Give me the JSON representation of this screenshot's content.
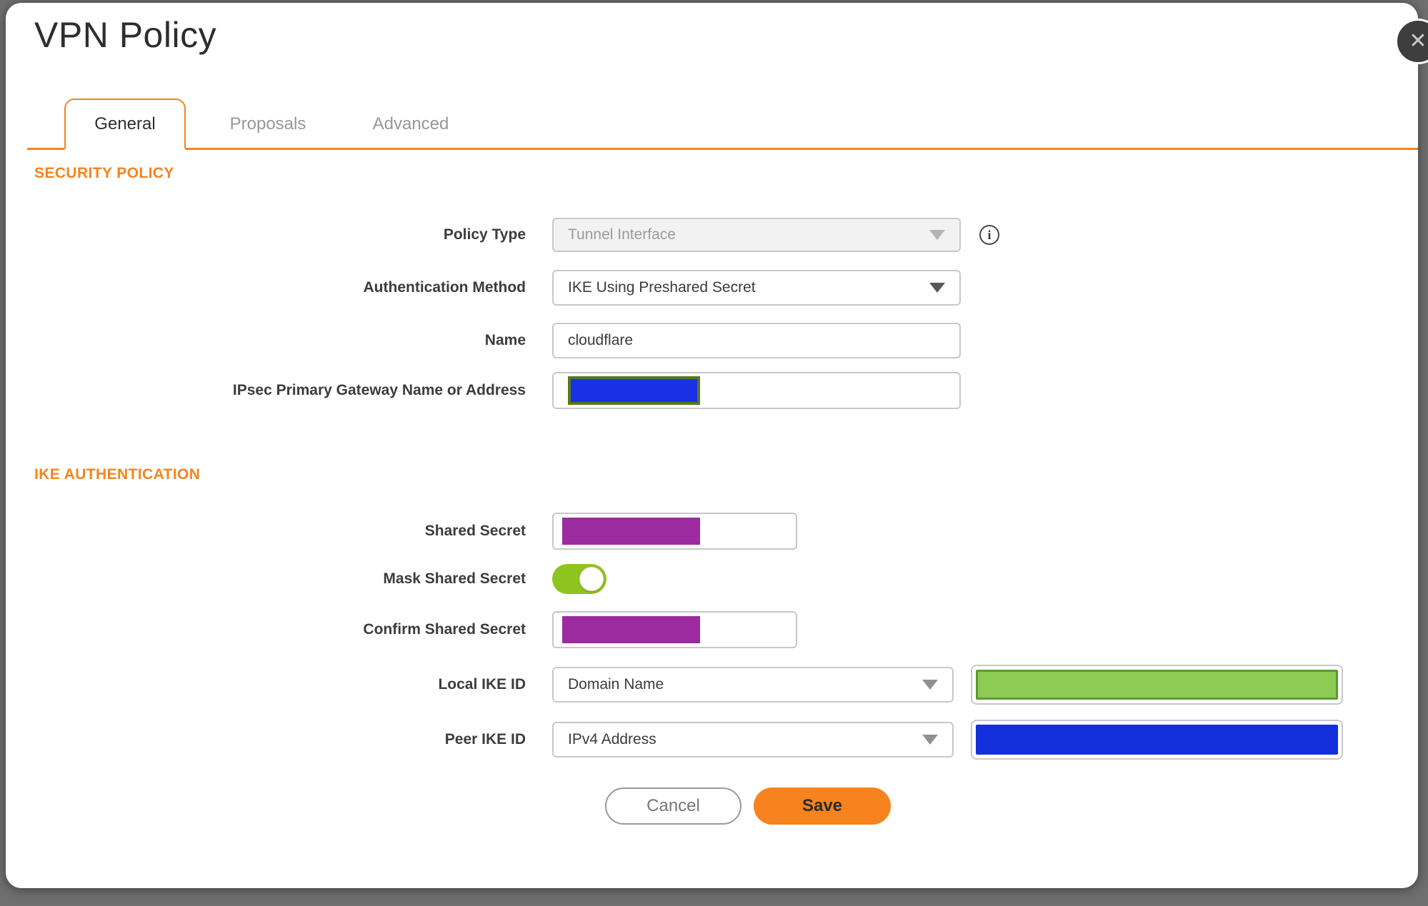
{
  "colors": {
    "accent": "#F6831D",
    "page_bg": "#6F6F6F",
    "tab_inactive": "#97979A",
    "label_text": "#3C3C3E",
    "muted_text": "#9B9B9B",
    "border": "#C8C8CC",
    "redact_purple": "#9C2BA0",
    "redact_blue": "#1430DC",
    "redact_gateway_blue": "#1A30E4",
    "redact_olive_border": "#55781E",
    "redact_green_fill": "#8ECB54",
    "redact_green_border": "#5C9B31",
    "toggle_green": "#8FC41F",
    "close_bg": "#3E3E3E",
    "close_x": "#C9C9C9"
  },
  "dialog": {
    "title": "VPN Policy"
  },
  "icons": {
    "close_glyph": "✕",
    "info_glyph": "i"
  },
  "tabs": [
    {
      "label": "General",
      "active": true
    },
    {
      "label": "Proposals",
      "active": false
    },
    {
      "label": "Advanced",
      "active": false
    }
  ],
  "sections": {
    "security_policy": "SECURITY POLICY",
    "ike_authentication": "IKE AUTHENTICATION"
  },
  "form": {
    "policy_type": {
      "label": "Policy Type",
      "value": "Tunnel Interface",
      "disabled": true
    },
    "authentication_method": {
      "label": "Authentication Method",
      "value": "IKE Using Preshared Secret"
    },
    "name": {
      "label": "Name",
      "value": "cloudflare"
    },
    "gateway": {
      "label": "IPsec Primary Gateway Name or Address",
      "value_redacted": true
    },
    "shared_secret": {
      "label": "Shared Secret",
      "value_redacted": true
    },
    "mask_shared_secret": {
      "label": "Mask Shared Secret",
      "enabled": true
    },
    "confirm_shared_secret": {
      "label": "Confirm Shared Secret",
      "value_redacted": true
    },
    "local_ike_id": {
      "label": "Local IKE ID",
      "type_value": "Domain Name",
      "id_value_redacted": true
    },
    "peer_ike_id": {
      "label": "Peer IKE ID",
      "type_value": "IPv4 Address",
      "id_value_redacted": true
    }
  },
  "buttons": {
    "cancel": "Cancel",
    "save": "Save"
  }
}
